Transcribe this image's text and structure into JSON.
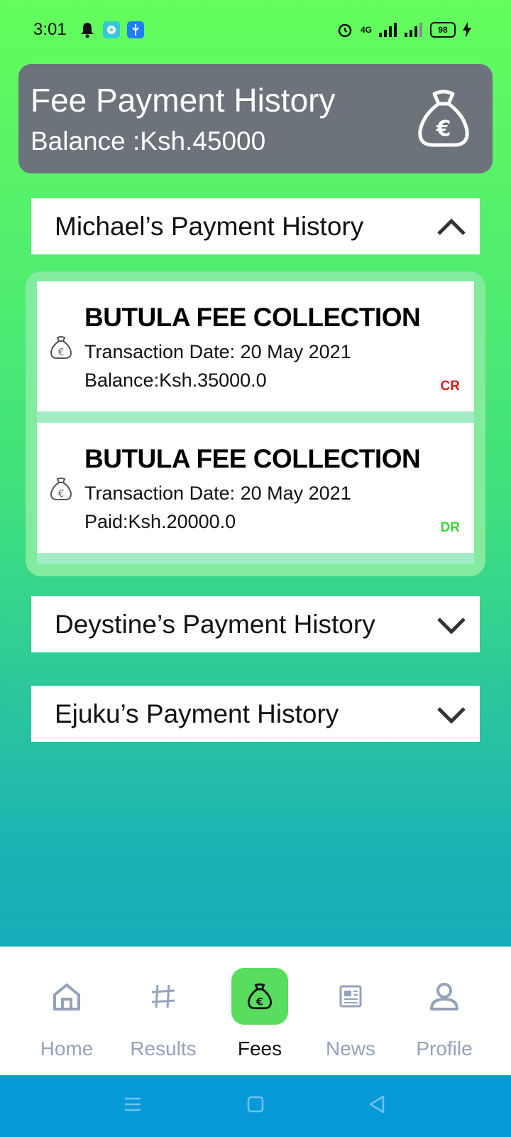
{
  "status_bar": {
    "time": "3:01",
    "battery": "98",
    "network": "4G",
    "icons": [
      "bell-icon",
      "chat-app-icon",
      "usb-icon",
      "alarm-icon",
      "signal-icon",
      "signal-icon-2",
      "battery-icon",
      "charging-icon"
    ]
  },
  "header": {
    "title": "Fee Payment History",
    "balance": "Balance :Ksh.45000",
    "icon": "money-bag-euro-icon"
  },
  "sections": [
    {
      "title": "Michael’s Payment History",
      "expanded": true,
      "transactions": [
        {
          "title": "BUTULA FEE COLLECTION",
          "date": "Transaction Date: 20 May 2021",
          "amount": "Balance:Ksh.35000.0",
          "type": "CR",
          "type_color": "#d61d1d"
        },
        {
          "title": "BUTULA FEE COLLECTION",
          "date": "Transaction Date: 20 May 2021",
          "amount": "Paid:Ksh.20000.0",
          "type": "DR",
          "type_color": "#3ed53a"
        }
      ]
    },
    {
      "title": "Deystine’s Payment History",
      "expanded": false
    },
    {
      "title": "Ejuku’s Payment History",
      "expanded": false
    }
  ],
  "bottom_nav": {
    "items": [
      {
        "label": "Home",
        "icon": "home-icon",
        "active": false
      },
      {
        "label": "Results",
        "icon": "results-icon",
        "active": false
      },
      {
        "label": "Fees",
        "icon": "fees-money-bag-icon",
        "active": true
      },
      {
        "label": "News",
        "icon": "news-icon",
        "active": false
      },
      {
        "label": "Profile",
        "icon": "profile-icon",
        "active": false
      }
    ]
  },
  "colors": {
    "gradient_top": "#64fd5c",
    "gradient_bottom": "#0fa4c4",
    "header_bg": "#6c737a",
    "active_nav": "#58dd5e",
    "system_nav": "#0899d9"
  }
}
